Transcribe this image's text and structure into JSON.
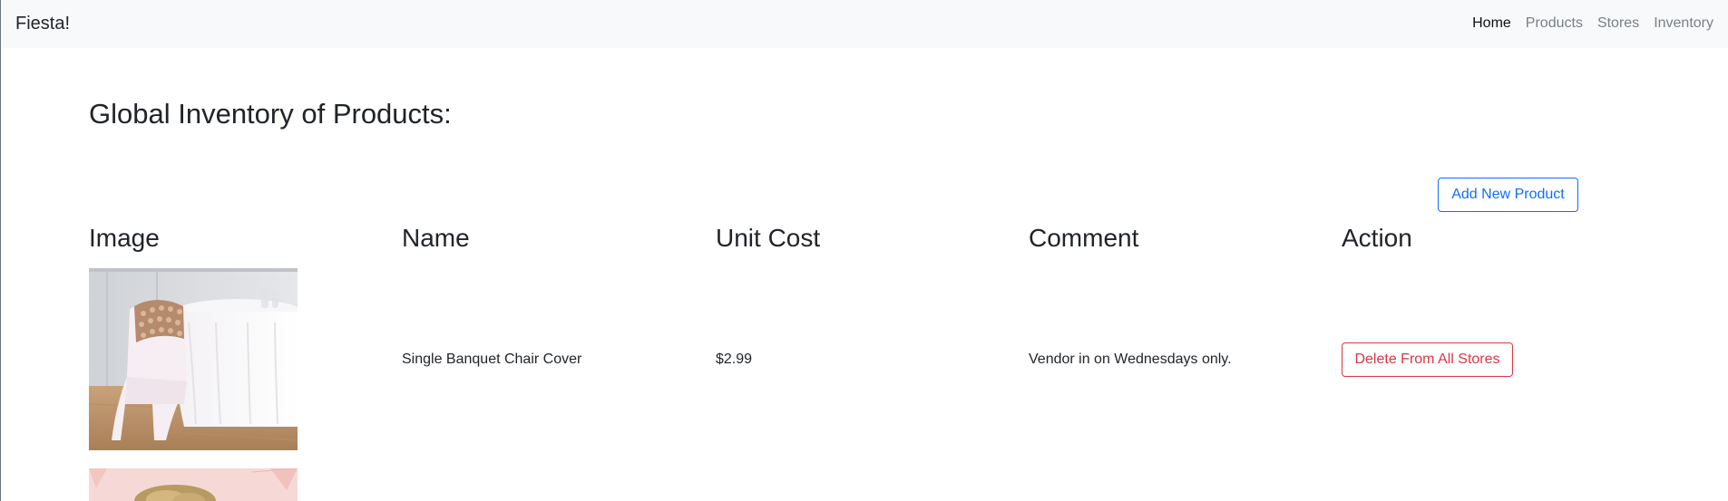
{
  "navbar": {
    "brand": "Fiesta!",
    "links": [
      "Home",
      "Products",
      "Stores",
      "Inventory"
    ],
    "active": "Home"
  },
  "page": {
    "title": "Global Inventory of Products:",
    "add_button": "Add New Product"
  },
  "table": {
    "headers": [
      "Image",
      "Name",
      "Unit Cost",
      "Comment",
      "Action"
    ],
    "rows": [
      {
        "image": "chair-cover-photo",
        "name": "Single Banquet Chair Cover",
        "unit_cost": "$2.99",
        "comment": "Vendor in on Wednesdays only.",
        "action": "Delete From All Stores"
      },
      {
        "image": "party-decor-photo"
      }
    ]
  },
  "colors": {
    "primary": "#0d6efd",
    "danger": "#dc3545",
    "navbar_bg": "#f8f9fa"
  }
}
